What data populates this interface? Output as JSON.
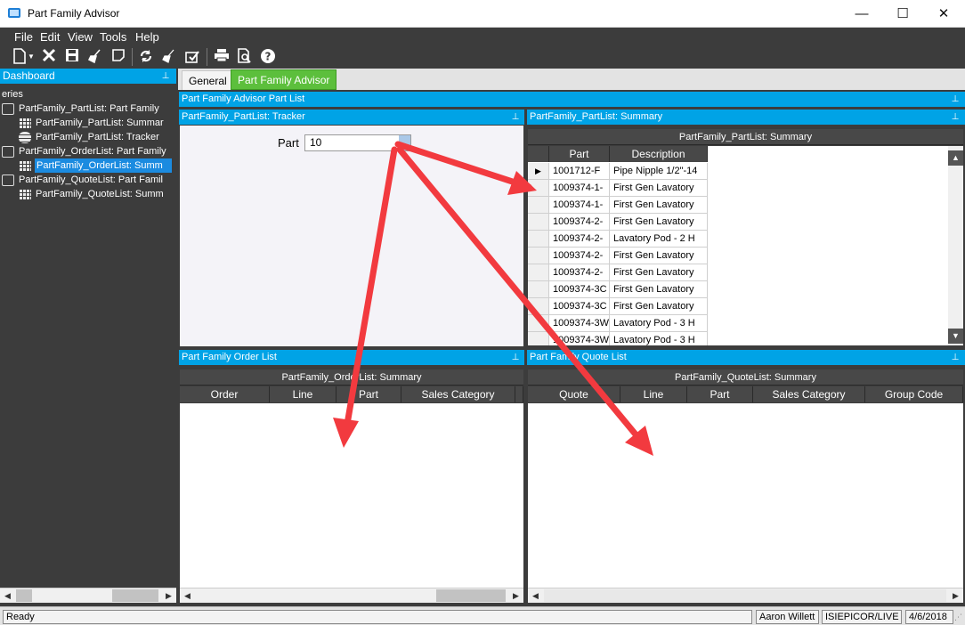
{
  "window": {
    "title": "Part Family Advisor",
    "minimize": "—",
    "maximize": "☐",
    "close": "✕"
  },
  "menu": [
    "File",
    "Edit",
    "View",
    "Tools",
    "Help"
  ],
  "toolbar_icons": [
    "new-icon",
    "dropdown-icon",
    "delete-icon",
    "save-icon",
    "clear-icon",
    "note-icon",
    "refresh-icon",
    "clear-all-icon",
    "edit-icon",
    "print-icon",
    "print-preview-icon",
    "help-icon"
  ],
  "left": {
    "header": "Dashboard",
    "pin": "⊥",
    "section": "eries",
    "tree": [
      {
        "label": "PartFamily_PartList: Part Family",
        "icon": "query-icon",
        "indent": 0
      },
      {
        "label": "PartFamily_PartList: Summar",
        "icon": "grid-icon",
        "indent": 1
      },
      {
        "label": "PartFamily_PartList: Tracker",
        "icon": "tracker-icon",
        "indent": 1
      },
      {
        "label": "PartFamily_OrderList: Part Family",
        "icon": "query-icon",
        "indent": 0
      },
      {
        "label": "PartFamily_OrderList: Summ",
        "icon": "grid-icon",
        "indent": 1,
        "selected": true
      },
      {
        "label": "PartFamily_QuoteList: Part Famil",
        "icon": "query-icon",
        "indent": 0
      },
      {
        "label": "PartFamily_QuoteList: Summ",
        "icon": "grid-icon",
        "indent": 1
      }
    ]
  },
  "tabs": {
    "general": "General",
    "pfa": "Part Family Advisor"
  },
  "partlist_header": "Part Family Advisor Part List",
  "tracker": {
    "header": "PartFamily_PartList: Tracker",
    "part_label": "Part",
    "part_value": "10"
  },
  "summary": {
    "header": "PartFamily_PartList: Summary",
    "caption": "PartFamily_PartList: Summary",
    "columns": [
      "Part",
      "Description"
    ],
    "rows": [
      [
        "1001712-F",
        "Pipe Nipple 1/2\"-14"
      ],
      [
        "1009374-1-",
        "First Gen Lavatory"
      ],
      [
        "1009374-1-",
        "First Gen Lavatory"
      ],
      [
        "1009374-2-",
        "First Gen Lavatory"
      ],
      [
        "1009374-2-",
        "Lavatory Pod - 2 H"
      ],
      [
        "1009374-2-",
        "First Gen Lavatory"
      ],
      [
        "1009374-2-",
        "First Gen Lavatory"
      ],
      [
        "1009374-3C",
        "First Gen Lavatory"
      ],
      [
        "1009374-3C",
        "First Gen Lavatory"
      ],
      [
        "1009374-3W",
        "Lavatory Pod - 3 H"
      ],
      [
        "1009374-3W",
        "Lavatory Pod - 3 H"
      ]
    ],
    "current_row_marker": "▶"
  },
  "orderlist": {
    "header": "Part Family Order List",
    "caption": "PartFamily_OrderList: Summary",
    "columns": [
      "Order",
      "Line",
      "Part",
      "Sales Category"
    ]
  },
  "quotelist": {
    "header": "Part Family Quote List",
    "caption": "PartFamily_QuoteList: Summary",
    "columns": [
      "Quote",
      "Line",
      "Part",
      "Sales Category",
      "Group Code"
    ]
  },
  "status": {
    "text": "Ready",
    "user": "Aaron Willett",
    "company": "ISIEPICOR/LIVE",
    "date": "4/6/2018"
  },
  "colors": {
    "accent": "#00a3e6",
    "tab_active": "#5cbf3c",
    "annotation_arrow": "#f23a3f"
  }
}
